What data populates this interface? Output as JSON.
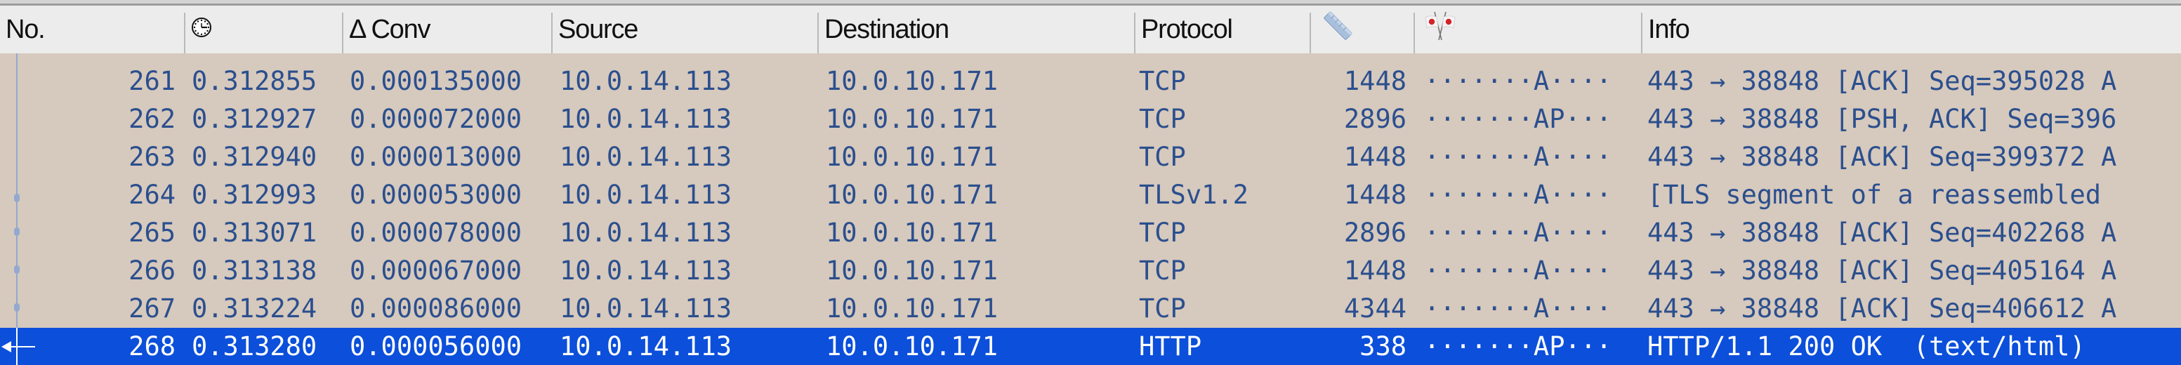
{
  "header": {
    "columns": [
      {
        "key": "no",
        "label": "No."
      },
      {
        "key": "time",
        "icon": "clock-icon",
        "label": ""
      },
      {
        "key": "delta",
        "label": "Δ Conv"
      },
      {
        "key": "source",
        "label": "Source"
      },
      {
        "key": "destination",
        "label": "Destination"
      },
      {
        "key": "protocol",
        "label": "Protocol"
      },
      {
        "key": "length",
        "icon": "ruler-icon",
        "label": ""
      },
      {
        "key": "flags",
        "icon": "crossed-flags-icon",
        "label": ""
      },
      {
        "key": "info",
        "label": "Info"
      }
    ]
  },
  "colors": {
    "row_bg": "#d6c9bd",
    "row_text": "#2b4f8e",
    "selected_bg": "#0b4fdb",
    "selected_text": "#ffffff",
    "header_bg": "#ececec"
  },
  "packets": [
    {
      "no": "261",
      "time": "0.312855",
      "delta": "0.000135000",
      "source": "10.0.14.113",
      "destination": "10.0.10.171",
      "protocol": "TCP",
      "length": "1448",
      "flags": "·······A····",
      "info": "443 → 38848 [ACK] Seq=395028 A",
      "selected": false
    },
    {
      "no": "262",
      "time": "0.312927",
      "delta": "0.000072000",
      "source": "10.0.14.113",
      "destination": "10.0.10.171",
      "protocol": "TCP",
      "length": "2896",
      "flags": "·······AP···",
      "info": "443 → 38848 [PSH, ACK] Seq=396",
      "selected": false
    },
    {
      "no": "263",
      "time": "0.312940",
      "delta": "0.000013000",
      "source": "10.0.14.113",
      "destination": "10.0.10.171",
      "protocol": "TCP",
      "length": "1448",
      "flags": "·······A····",
      "info": "443 → 38848 [ACK] Seq=399372 A",
      "selected": false
    },
    {
      "no": "264",
      "time": "0.312993",
      "delta": "0.000053000",
      "source": "10.0.14.113",
      "destination": "10.0.10.171",
      "protocol": "TLSv1.2",
      "length": "1448",
      "flags": "·······A····",
      "info": "[TLS segment of a reassembled ",
      "selected": false
    },
    {
      "no": "265",
      "time": "0.313071",
      "delta": "0.000078000",
      "source": "10.0.14.113",
      "destination": "10.0.10.171",
      "protocol": "TCP",
      "length": "2896",
      "flags": "·······A····",
      "info": "443 → 38848 [ACK] Seq=402268 A",
      "selected": false
    },
    {
      "no": "266",
      "time": "0.313138",
      "delta": "0.000067000",
      "source": "10.0.14.113",
      "destination": "10.0.10.171",
      "protocol": "TCP",
      "length": "1448",
      "flags": "·······A····",
      "info": "443 → 38848 [ACK] Seq=405164 A",
      "selected": false
    },
    {
      "no": "267",
      "time": "0.313224",
      "delta": "0.000086000",
      "source": "10.0.14.113",
      "destination": "10.0.10.171",
      "protocol": "TCP",
      "length": "4344",
      "flags": "·······A····",
      "info": "443 → 38848 [ACK] Seq=406612 A",
      "selected": false
    },
    {
      "no": "268",
      "time": "0.313280",
      "delta": "0.000056000",
      "source": "10.0.14.113",
      "destination": "10.0.10.171",
      "protocol": "HTTP",
      "length": "338",
      "flags": "·······AP···",
      "info": "HTTP/1.1 200 OK  (text/html)",
      "selected": true
    }
  ]
}
